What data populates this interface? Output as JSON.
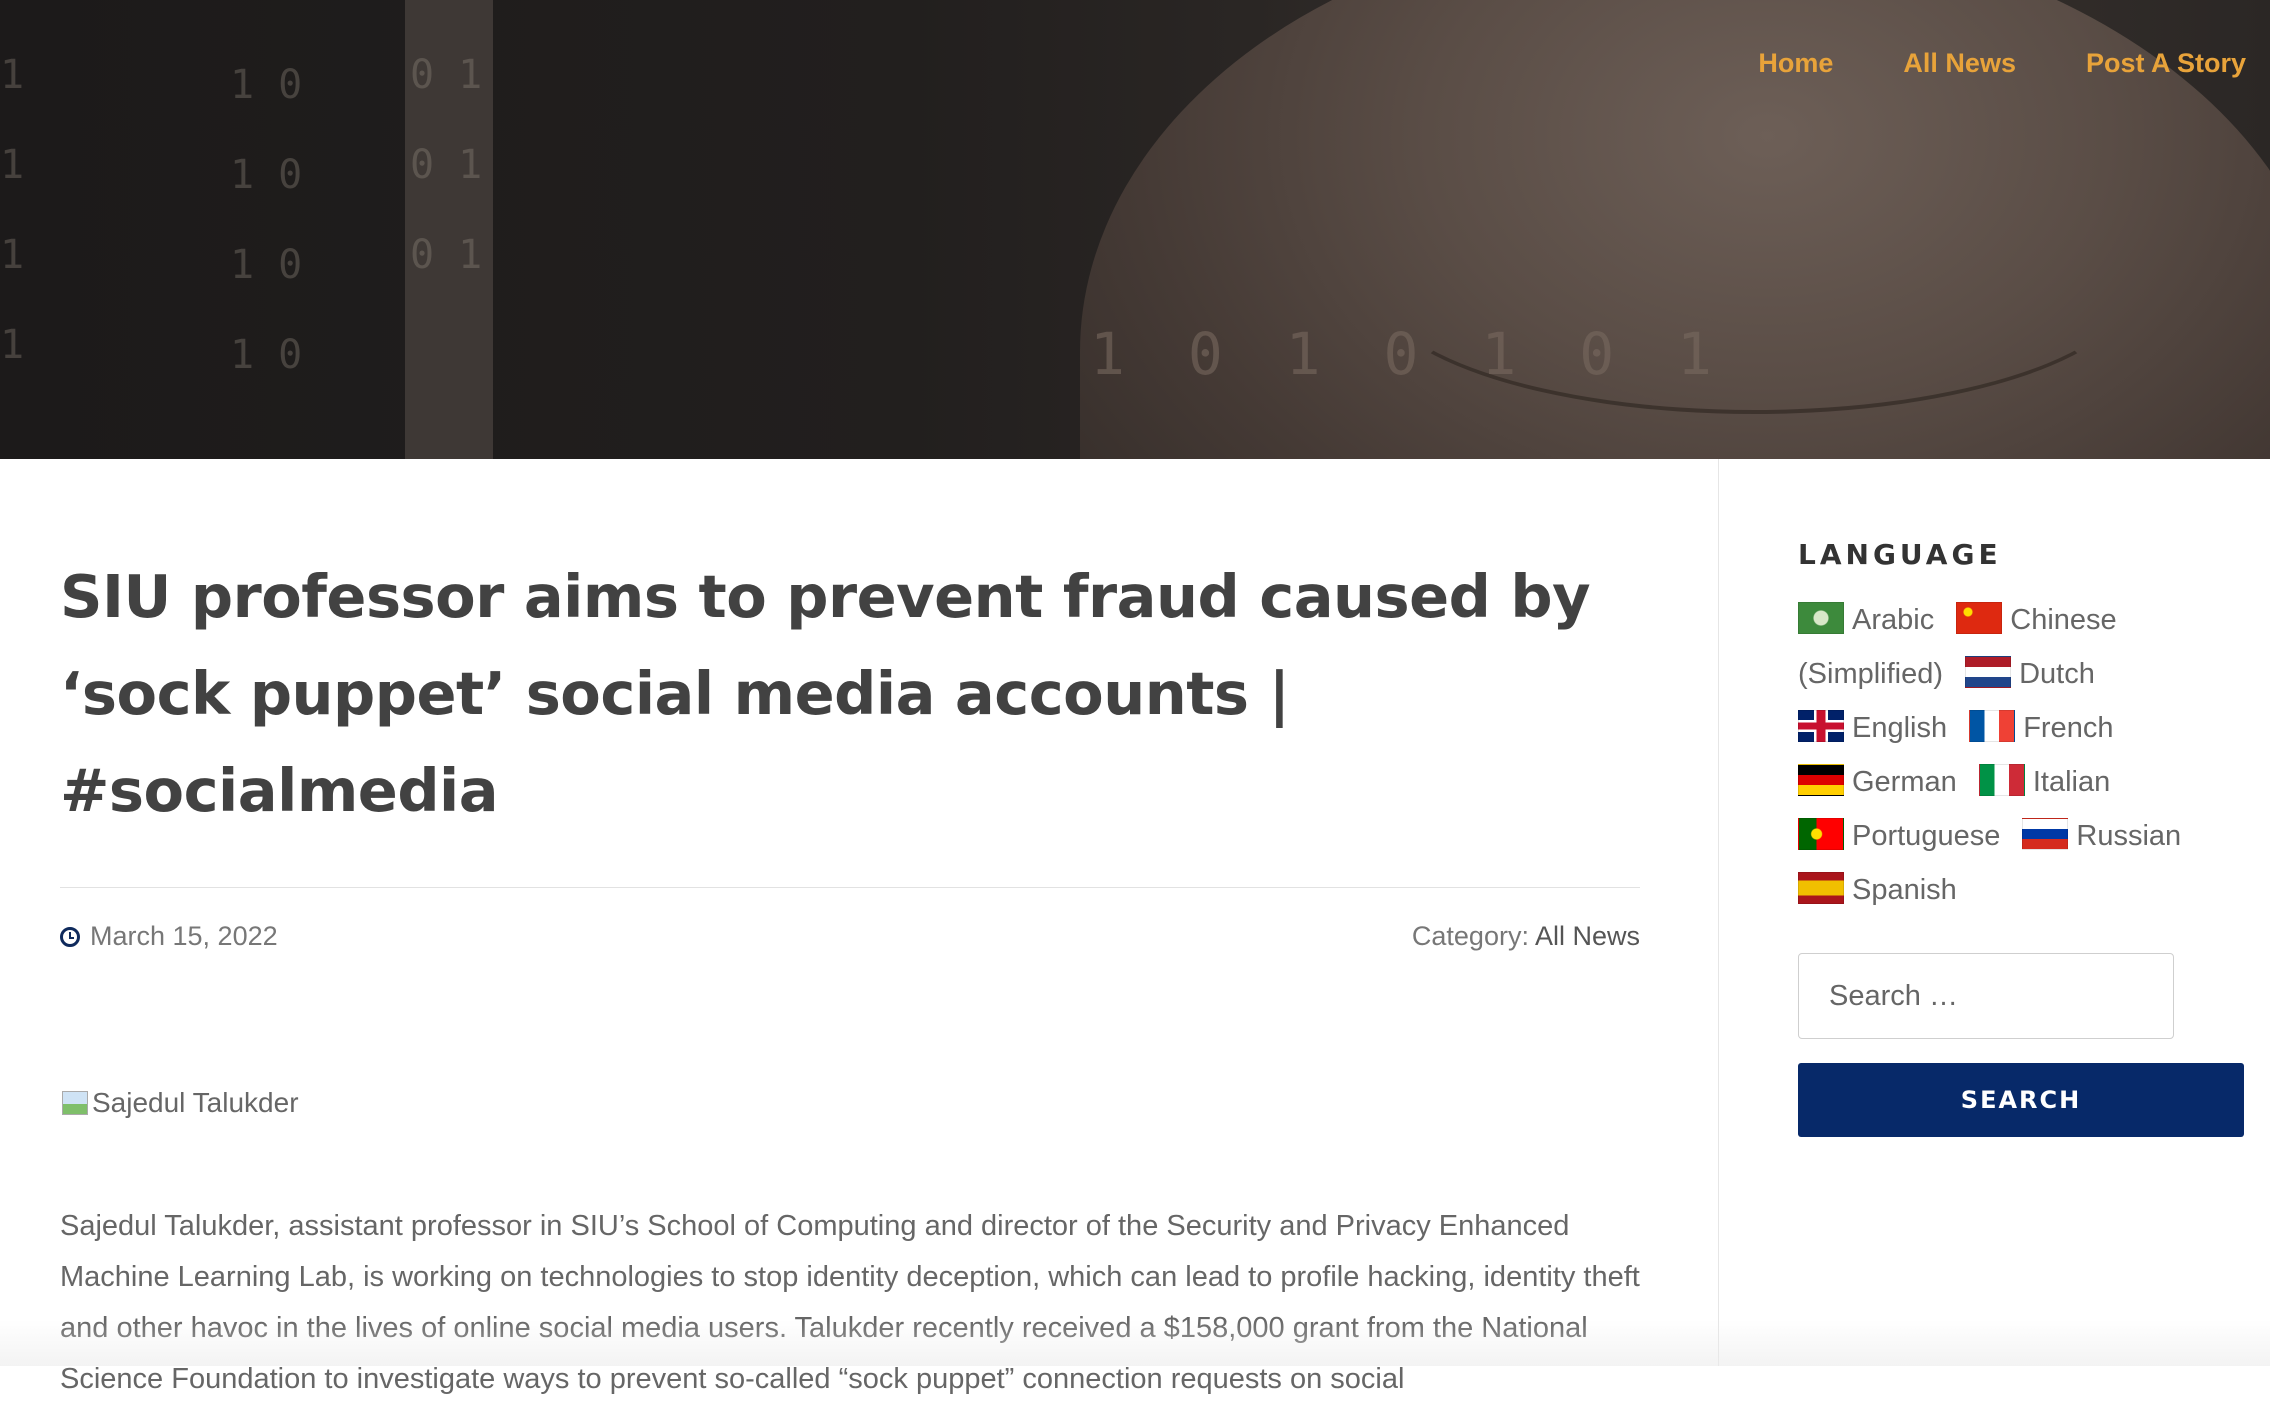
{
  "nav": {
    "items": [
      {
        "label": "Home"
      },
      {
        "label": "All News"
      },
      {
        "label": "Post A Story"
      }
    ]
  },
  "hero": {
    "code_columns": [
      "1\n1\n1\n1",
      "1 0\n1 0\n1 0\n1 0",
      "0 1\n0 1\n0 1"
    ],
    "overlay_text": "1 0 1 0 1 0 1"
  },
  "article": {
    "title": "SIU professor aims to prevent fraud caused by ‘sock puppet’ social media accounts | #socialmedia",
    "date": "March 15, 2022",
    "category_label": "Category:",
    "category_value": "All News",
    "image_alt": "Sajedul Talukder",
    "body": "Sajedul Talukder, assistant professor in SIU’s School of Computing and director of the Security and Privacy Enhanced Machine Learning Lab, is working on technologies to stop identity deception, which can lead to profile hacking, identity theft and other havoc in the lives of online social media users. Talukder recently received a $158,000 grant from the National Science Foundation to investigate ways to prevent so-called “sock puppet” connection requests on social"
  },
  "sidebar": {
    "language_title": "LANGUAGE",
    "languages": [
      {
        "label": "Arabic",
        "flag": "ar"
      },
      {
        "label": "Chinese (Simplified)",
        "flag": "zh"
      },
      {
        "label": "Dutch",
        "flag": "nl"
      },
      {
        "label": "English",
        "flag": "en"
      },
      {
        "label": "French",
        "flag": "fr"
      },
      {
        "label": "German",
        "flag": "de"
      },
      {
        "label": "Italian",
        "flag": "it"
      },
      {
        "label": "Portuguese",
        "flag": "pt"
      },
      {
        "label": "Russian",
        "flag": "ru"
      },
      {
        "label": "Spanish",
        "flag": "es"
      }
    ],
    "search_placeholder": "Search …",
    "search_button": "SEARCH"
  },
  "colors": {
    "nav_accent": "#e8a33a",
    "button_bg": "#072969",
    "title": "#424242"
  }
}
